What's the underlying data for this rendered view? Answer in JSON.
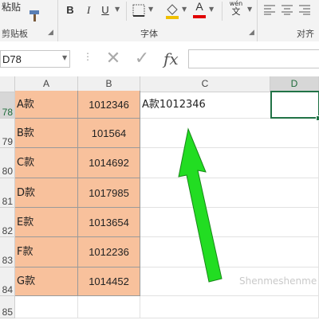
{
  "ribbon": {
    "paste_label": "粘贴",
    "clipboard_group": "剪贴板",
    "font_group": "字体",
    "align_group": "对齐方",
    "bold": "B",
    "italic": "I",
    "underline": "U",
    "font_color_glyph": "A",
    "wen_glyph": "wén",
    "wen_char": "文"
  },
  "formula_bar": {
    "name_box": "D78",
    "cancel_glyph": "✕",
    "enter_glyph": "✓",
    "fx_glyph": "fx",
    "formula_value": ""
  },
  "columns": [
    "A",
    "B",
    "C",
    "D"
  ],
  "rows": [
    {
      "num": "78",
      "a": "A款",
      "b": "1012346",
      "c": "A款1012346"
    },
    {
      "num": "79",
      "a": "B款",
      "b": "101564",
      "c": ""
    },
    {
      "num": "80",
      "a": "C款",
      "b": "1014692",
      "c": ""
    },
    {
      "num": "81",
      "a": "D款",
      "b": "1017985",
      "c": ""
    },
    {
      "num": "82",
      "a": "E款",
      "b": "1013654",
      "c": ""
    },
    {
      "num": "83",
      "a": "F款",
      "b": "1012236",
      "c": ""
    },
    {
      "num": "84",
      "a": "G款",
      "b": "1014452",
      "c": ""
    },
    {
      "num": "85",
      "a": "",
      "b": "",
      "c": ""
    }
  ],
  "selected_cell": "D78",
  "colors": {
    "data_fill": "#f8c19c",
    "arrow": "#22dd22",
    "selection": "#217346"
  },
  "watermark_text": "Shenmeshenme"
}
